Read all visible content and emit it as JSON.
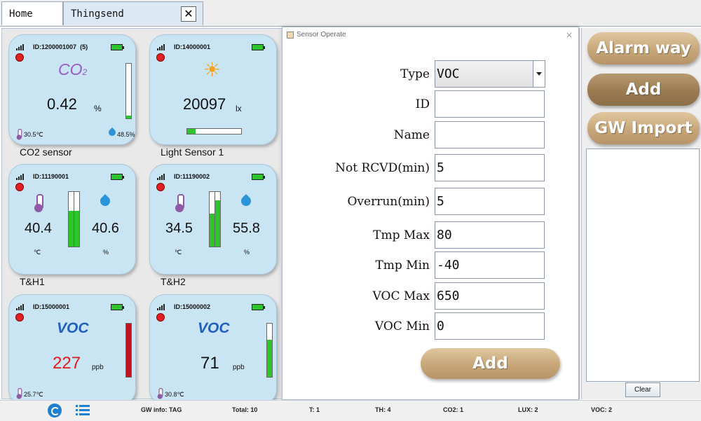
{
  "tabs": {
    "home": "Home",
    "things": "Thingsend"
  },
  "cards": {
    "co2": {
      "id": "ID:1200001007",
      "extra": "(5)",
      "title": "CO",
      "sub": "2",
      "value": "0.42",
      "unit": "%",
      "temp": "30.5℃",
      "hum": "48.5%",
      "caption": "CO2 sensor",
      "level": 0.05
    },
    "light": {
      "id": "ID:14000001",
      "value": "20097",
      "unit": "lx",
      "caption": "Light Sensor 1",
      "level": 0.15
    },
    "th1": {
      "id": "ID:11190001",
      "temp": "40.4",
      "hum": "40.6",
      "tunit": "℃",
      "hunit": "%",
      "caption": "T&H1",
      "tlevel": 0.65,
      "hlevel": 0.65
    },
    "th2": {
      "id": "ID:11190002",
      "temp": "34.5",
      "hum": "55.8",
      "tunit": "℃",
      "hunit": "%",
      "caption": "T&H2",
      "tlevel": 0.6,
      "hlevel": 0.85
    },
    "voc1": {
      "id": "ID:15000001",
      "title": "VOC",
      "value": "227",
      "unit": "ppb",
      "temp": "25.7℃",
      "level": 1.0
    },
    "voc2": {
      "id": "ID:15000002",
      "title": "VOC",
      "value": "71",
      "unit": "ppb",
      "temp": "30.8℃",
      "level": 0.7
    }
  },
  "dialog": {
    "title": "Sensor Operate",
    "close": "×",
    "fields": {
      "type": {
        "label": "Type",
        "value": "VOC"
      },
      "id": {
        "label": "ID",
        "value": ""
      },
      "name": {
        "label": "Name",
        "value": ""
      },
      "not_rcvd": {
        "label": "Not RCVD(min)",
        "value": "5"
      },
      "overrun": {
        "label": "Overrun(min)",
        "value": "5"
      },
      "tmp_max": {
        "label": "Tmp Max",
        "value": "80"
      },
      "tmp_min": {
        "label": "Tmp Min",
        "value": "-40"
      },
      "voc_max": {
        "label": "VOC Max",
        "value": "650"
      },
      "voc_min": {
        "label": "VOC Min",
        "value": "0"
      }
    },
    "add_label": "Add"
  },
  "right": {
    "alarm_label": "Alarm way",
    "add_label": "Add",
    "gw_label": "GW Import",
    "clear_label": "Clear"
  },
  "status": {
    "gw": "GW info: TAG",
    "total": "Total: 10",
    "t": "T: 1",
    "th": "TH: 4",
    "co2": "CO2: 1",
    "lux": "LUX: 2",
    "voc": "VOC: 2"
  },
  "colors": {
    "battery": "#2ec42e",
    "alarm_dot": "#e02020",
    "voc_value": "#e11b1b",
    "voc_bar_red": "#c0141c",
    "green_bar": "#2ec42e",
    "button_tan": "#c7a77a",
    "button_dark": "#9a7b52"
  }
}
